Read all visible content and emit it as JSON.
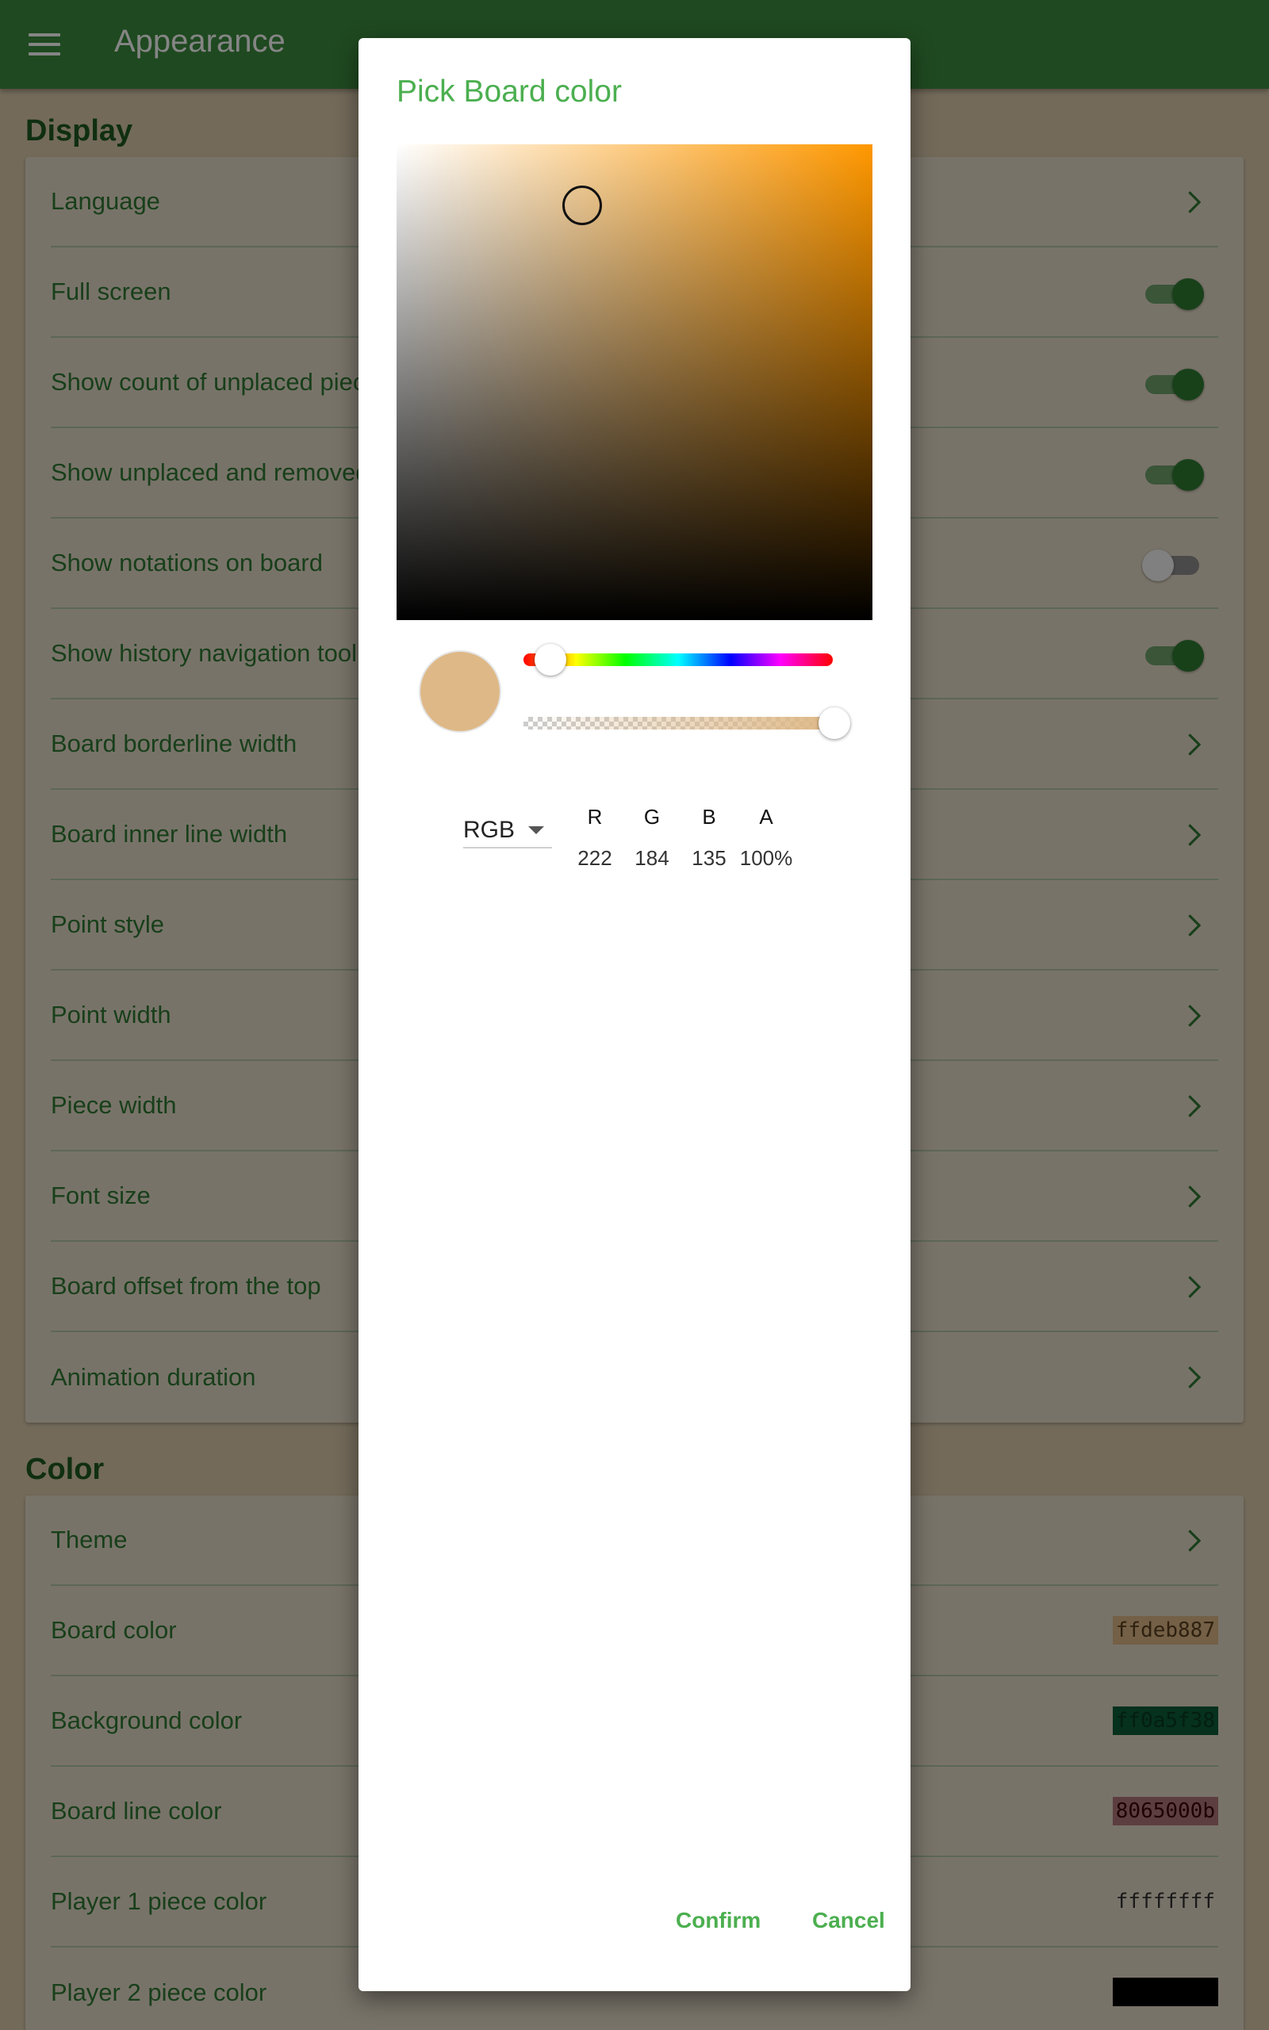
{
  "appbar": {
    "title": "Appearance",
    "menu_icon": "menu-icon"
  },
  "display_section": {
    "title": "Display",
    "rows": [
      {
        "label": "Language",
        "control": "chevron"
      },
      {
        "label": "Full screen",
        "control": "toggle",
        "value": true
      },
      {
        "label": "Show count of unplaced pieces",
        "control": "toggle",
        "value": true
      },
      {
        "label": "Show unplaced and removed pieces",
        "control": "toggle",
        "value": true
      },
      {
        "label": "Show notations on board",
        "control": "toggle",
        "value": false
      },
      {
        "label": "Show history navigation toolbar",
        "control": "toggle",
        "value": true
      },
      {
        "label": "Board borderline width",
        "control": "chevron"
      },
      {
        "label": "Board inner line width",
        "control": "chevron"
      },
      {
        "label": "Point style",
        "control": "chevron"
      },
      {
        "label": "Point width",
        "control": "chevron"
      },
      {
        "label": "Piece width",
        "control": "chevron"
      },
      {
        "label": "Font size",
        "control": "chevron"
      },
      {
        "label": "Board offset from the top",
        "control": "chevron"
      },
      {
        "label": "Animation duration",
        "control": "chevron"
      }
    ]
  },
  "color_section": {
    "title": "Color",
    "rows": [
      {
        "label": "Theme",
        "control": "chevron"
      },
      {
        "label": "Board color",
        "control": "swatch",
        "value": "ffdeb887",
        "bg": "#deb887",
        "fg": "#5a4020"
      },
      {
        "label": "Background color",
        "control": "swatch",
        "value": "ff0a5f38",
        "bg": "#0a5f38",
        "fg": "#0a3a20"
      },
      {
        "label": "Board line color",
        "control": "swatch",
        "value": "8065000b",
        "bg": "#b2777c",
        "fg": "#3a0008"
      },
      {
        "label": "Player 1 piece color",
        "control": "swatch",
        "value": "ffffffff",
        "bg": "transparent",
        "fg": "#333333"
      },
      {
        "label": "Player 2 piece color",
        "control": "swatch",
        "value": "ff000000",
        "bg": "#000000",
        "fg": "#000000"
      }
    ]
  },
  "dialog": {
    "title": "Pick Board color",
    "hue_color": "#ff9800",
    "selected_color": "#deb887",
    "mode": "RGB",
    "channels": [
      {
        "name": "R",
        "value": "222"
      },
      {
        "name": "G",
        "value": "184"
      },
      {
        "name": "B",
        "value": "135"
      },
      {
        "name": "A",
        "value": "100%"
      }
    ],
    "confirm_label": "Confirm",
    "cancel_label": "Cancel"
  }
}
